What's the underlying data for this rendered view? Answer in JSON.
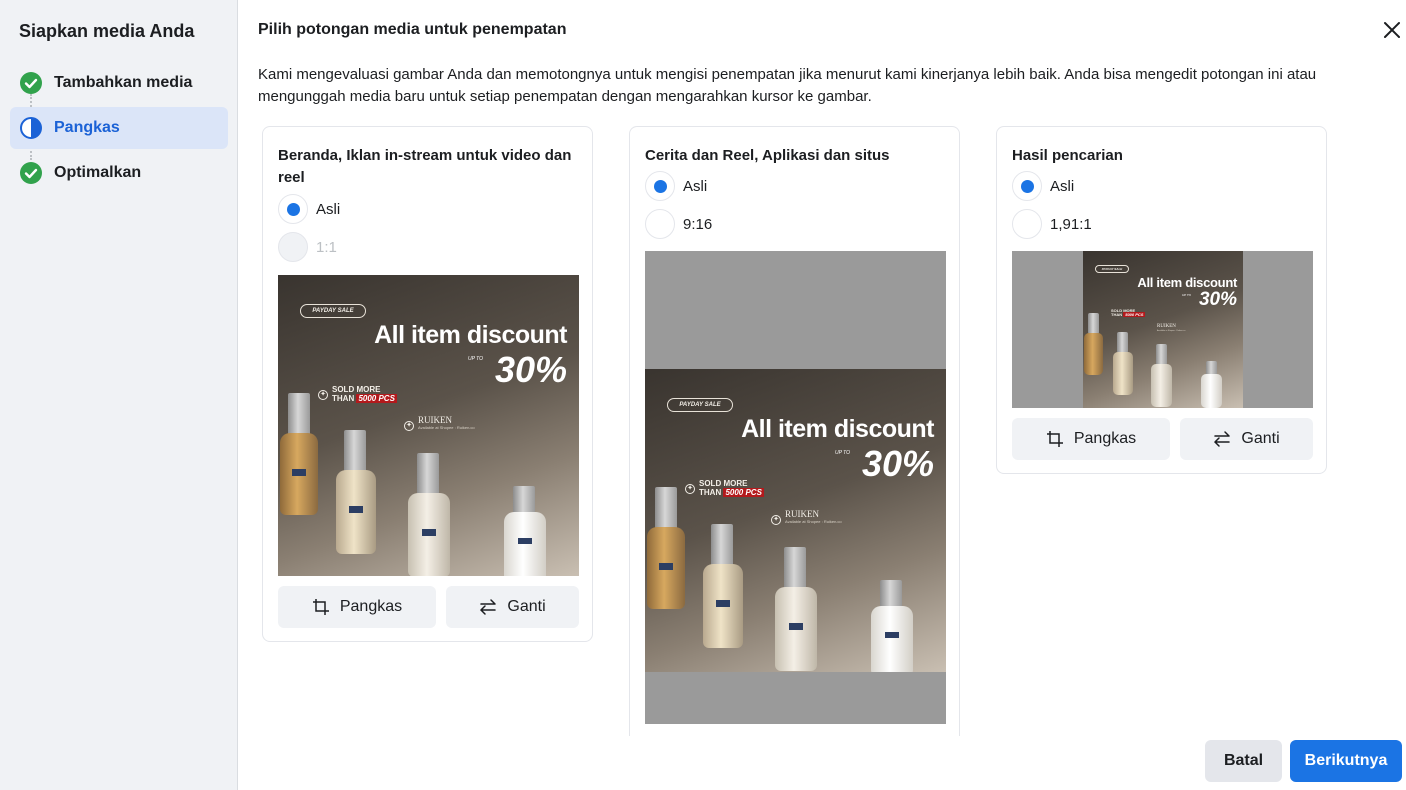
{
  "sidebar": {
    "title": "Siapkan media Anda",
    "steps": [
      {
        "label": "Tambahkan media",
        "status": "done"
      },
      {
        "label": "Pangkas",
        "status": "active"
      },
      {
        "label": "Optimalkan",
        "status": "done"
      }
    ]
  },
  "main": {
    "title": "Pilih potongan media untuk penempatan",
    "description": "Kami mengevaluasi gambar Anda dan memotongnya untuk mengisi penempatan jika menurut kami kinerjanya lebih baik. Anda bisa mengedit potongan ini atau mengunggah media baru untuk setiap penempatan dengan mengarahkan kursor ke gambar."
  },
  "placements": [
    {
      "title": "Beranda, Iklan in-stream untuk video dan reel",
      "options": [
        {
          "label": "Asli",
          "selected": true,
          "disabled": false
        },
        {
          "label": "1:1",
          "selected": false,
          "disabled": true
        }
      ],
      "crop_label": "Pangkas",
      "replace_label": "Ganti"
    },
    {
      "title": "Cerita dan Reel, Aplikasi dan situs",
      "options": [
        {
          "label": "Asli",
          "selected": true,
          "disabled": false
        },
        {
          "label": "9:16",
          "selected": false,
          "disabled": false
        }
      ]
    },
    {
      "title": "Hasil pencarian",
      "options": [
        {
          "label": "Asli",
          "selected": true,
          "disabled": false
        },
        {
          "label": "1,91:1",
          "selected": false,
          "disabled": false
        }
      ],
      "crop_label": "Pangkas",
      "replace_label": "Ganti"
    }
  ],
  "creative": {
    "badge": "PAYDAY SALE",
    "headline": "All item discount",
    "up_to": "UP TO",
    "percent": "30%",
    "sold_line1": "SOLD MORE",
    "sold_line2_prefix": "THAN",
    "sold_highlight": "5000 PCS",
    "brand": "RUIKEN",
    "availability": "Available at Shopee : Ruiken.co"
  },
  "footer": {
    "cancel_label": "Batal",
    "next_label": "Berikutnya"
  },
  "colors": {
    "accent": "#1b74e4",
    "success": "#31a24c",
    "sidebar_bg": "#f0f2f5"
  },
  "icons": {
    "close": "close-icon",
    "crop": "crop-icon",
    "replace": "swap-icon",
    "step_done": "check-circle-icon",
    "step_active": "half-circle-icon"
  }
}
